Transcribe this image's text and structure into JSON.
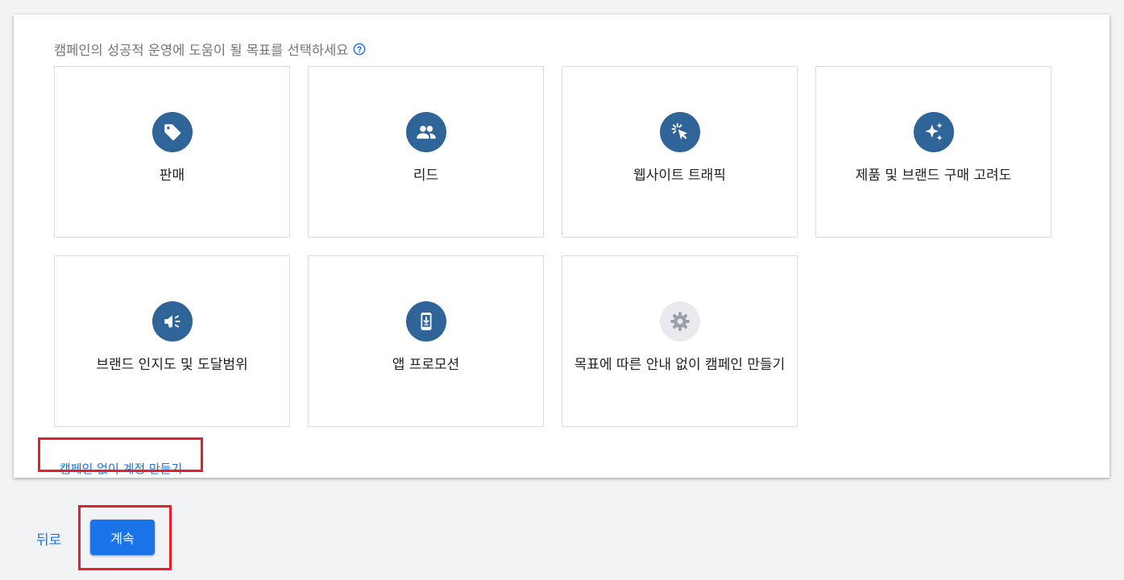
{
  "goal_prompt": {
    "text": "캠페인의 성공적 운영에 도움이 될 목표를 선택하세요",
    "help_icon": "help-circle-icon"
  },
  "goals": [
    {
      "label": "판매",
      "icon": "tag-icon"
    },
    {
      "label": "리드",
      "icon": "people-icon"
    },
    {
      "label": "웹사이트 트래픽",
      "icon": "cursor-click-icon"
    },
    {
      "label": "제품 및 브랜드 구매 고려도",
      "icon": "sparkle-icon"
    },
    {
      "label": "브랜드 인지도 및 도달범위",
      "icon": "megaphone-icon"
    },
    {
      "label": "앱 프로모션",
      "icon": "phone-download-icon"
    },
    {
      "label": "목표에 따른 안내 없이 캠페인 만들기",
      "icon": "gear-icon"
    }
  ],
  "create_account_link": "캠페인 없이 계정 만들기",
  "footer": {
    "back_label": "뒤로",
    "continue_label": "계속"
  },
  "colors": {
    "icon_circle": "#2f6498",
    "icon_circle_disabled": "#e8eaed",
    "link": "#1a73e8",
    "primary_button": "#1a73e8",
    "highlight": "#e0202a"
  }
}
